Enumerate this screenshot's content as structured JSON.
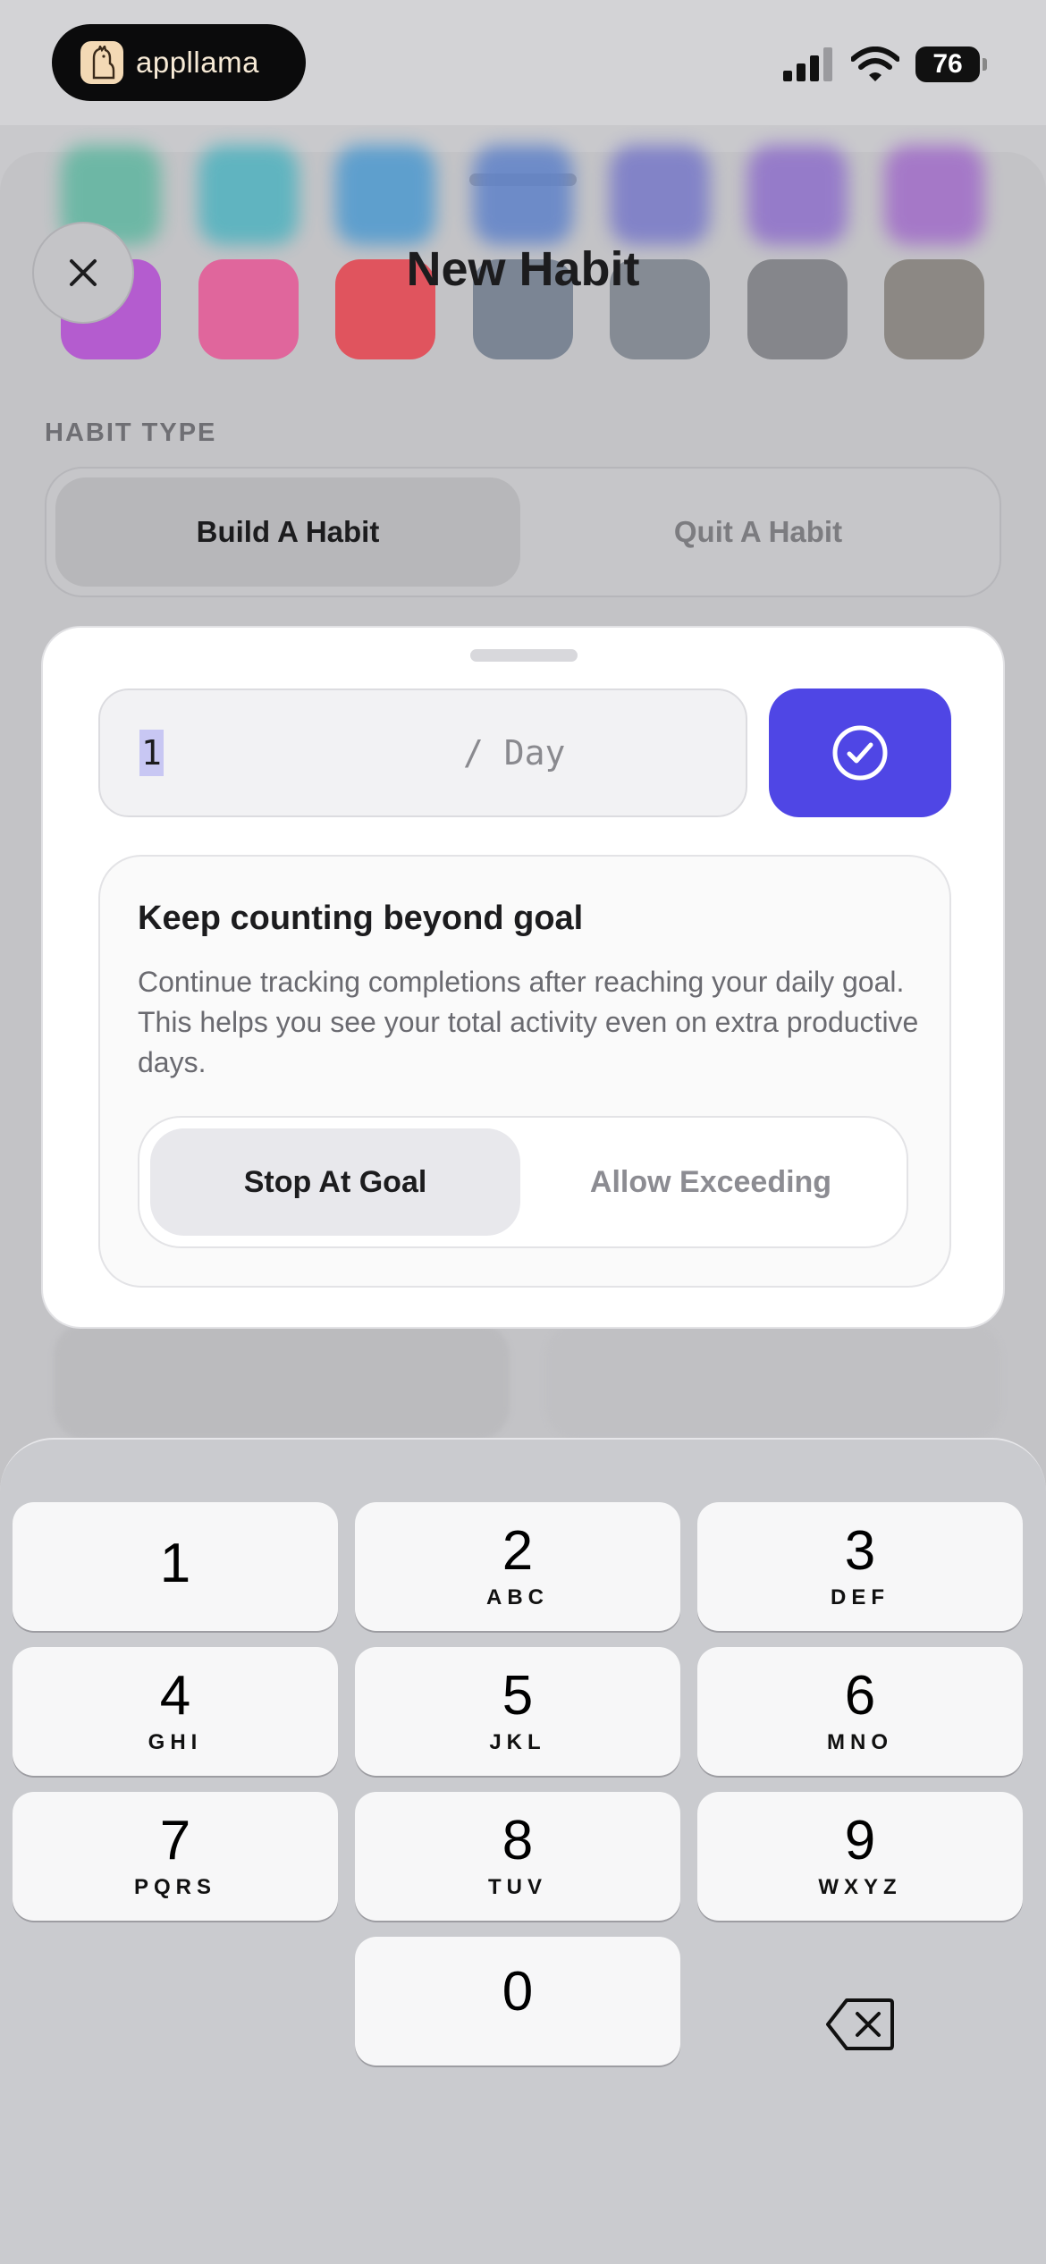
{
  "status_bar": {
    "brand": "appllama",
    "battery": "76"
  },
  "background_sheet": {
    "title": "New Habit",
    "habit_type_label": "HABIT TYPE",
    "habit_type_options": [
      "Build A Habit",
      "Quit A Habit"
    ],
    "selected_habit_type": "Build A Habit",
    "top_swatch_colors": [
      "#5fb6a0",
      "#4fb2bf",
      "#4d99cf",
      "#5f82c9",
      "#7778c8",
      "#8e6fca",
      "#a06cc8"
    ],
    "swatch_colors": [
      "#b45ccf",
      "#e0669c",
      "#e0545e",
      "#7b8594",
      "#858b94",
      "#85868b",
      "#8c8884"
    ]
  },
  "goal_modal": {
    "goal_value": "1",
    "goal_unit": "/ Day",
    "confirm_icon": "check-circle-icon",
    "info_title": "Keep counting beyond goal",
    "info_description": "Continue tracking completions after reaching your daily goal. This helps you see your total activity even on extra productive days.",
    "mode_options": [
      "Stop At Goal",
      "Allow Exceeding"
    ],
    "selected_mode": "Stop At Goal",
    "accent_color": "#4f46e5"
  },
  "keypad": {
    "keys": [
      {
        "num": "1",
        "letters": ""
      },
      {
        "num": "2",
        "letters": "ABC"
      },
      {
        "num": "3",
        "letters": "DEF"
      },
      {
        "num": "4",
        "letters": "GHI"
      },
      {
        "num": "5",
        "letters": "JKL"
      },
      {
        "num": "6",
        "letters": "MNO"
      },
      {
        "num": "7",
        "letters": "PQRS"
      },
      {
        "num": "8",
        "letters": "TUV"
      },
      {
        "num": "9",
        "letters": "WXYZ"
      },
      {
        "num": "0",
        "letters": ""
      }
    ],
    "delete_icon": "backspace-icon"
  }
}
